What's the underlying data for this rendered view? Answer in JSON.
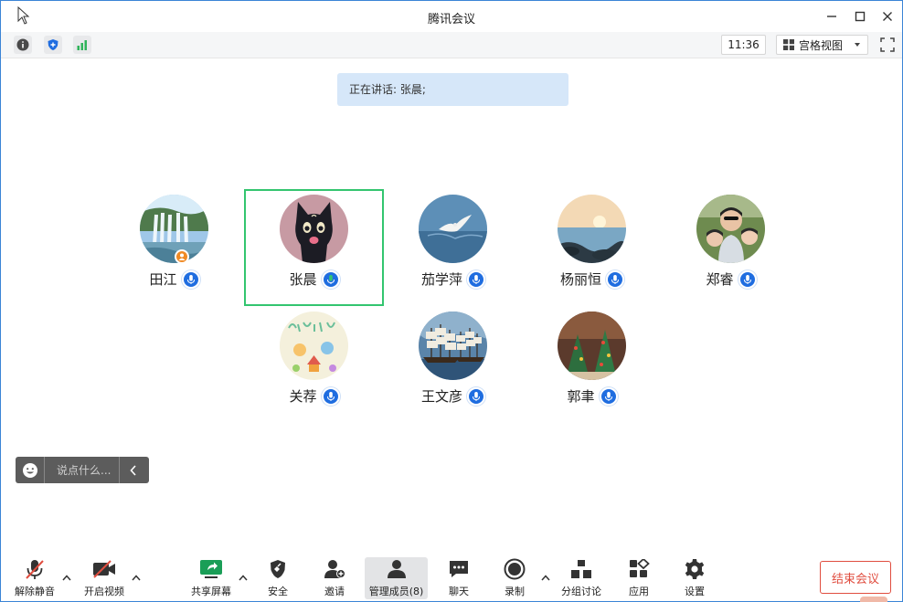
{
  "window": {
    "title": "腾讯会议"
  },
  "toolbar": {
    "clock": "11:36",
    "view_mode": "宫格视图"
  },
  "speaker_banner": {
    "text": "正在讲话: 张晨;"
  },
  "participants": [
    {
      "name": "田江",
      "avatar": "waterfall",
      "host": true
    },
    {
      "name": "张晨",
      "avatar": "black-cat",
      "speaking": true
    },
    {
      "name": "茄学萍",
      "avatar": "seagull"
    },
    {
      "name": "杨丽恒",
      "avatar": "seaside-sunset"
    },
    {
      "name": "郑睿",
      "avatar": "family-selfie"
    },
    {
      "name": "关荐",
      "avatar": "family-drawing"
    },
    {
      "name": "王文彦",
      "avatar": "sailing-ship"
    },
    {
      "name": "郭聿",
      "avatar": "christmas-street"
    }
  ],
  "chat": {
    "placeholder": "说点什么..."
  },
  "bottom_bar": {
    "unmute": "解除静音",
    "start_video": "开启视频",
    "share_screen": "共享屏幕",
    "security": "安全",
    "invite": "邀请",
    "manage_members": "管理成员(8)",
    "chat": "聊天",
    "record": "录制",
    "breakout": "分组讨论",
    "apps": "应用",
    "settings": "设置",
    "end_meeting": "结束会议"
  },
  "colors": {
    "accent": "#1f6de0",
    "speaking_frame": "#33c56f",
    "end_button": "#e04d3f",
    "banner_bg": "#d6e7f9",
    "host_badge": "#f08a24"
  }
}
